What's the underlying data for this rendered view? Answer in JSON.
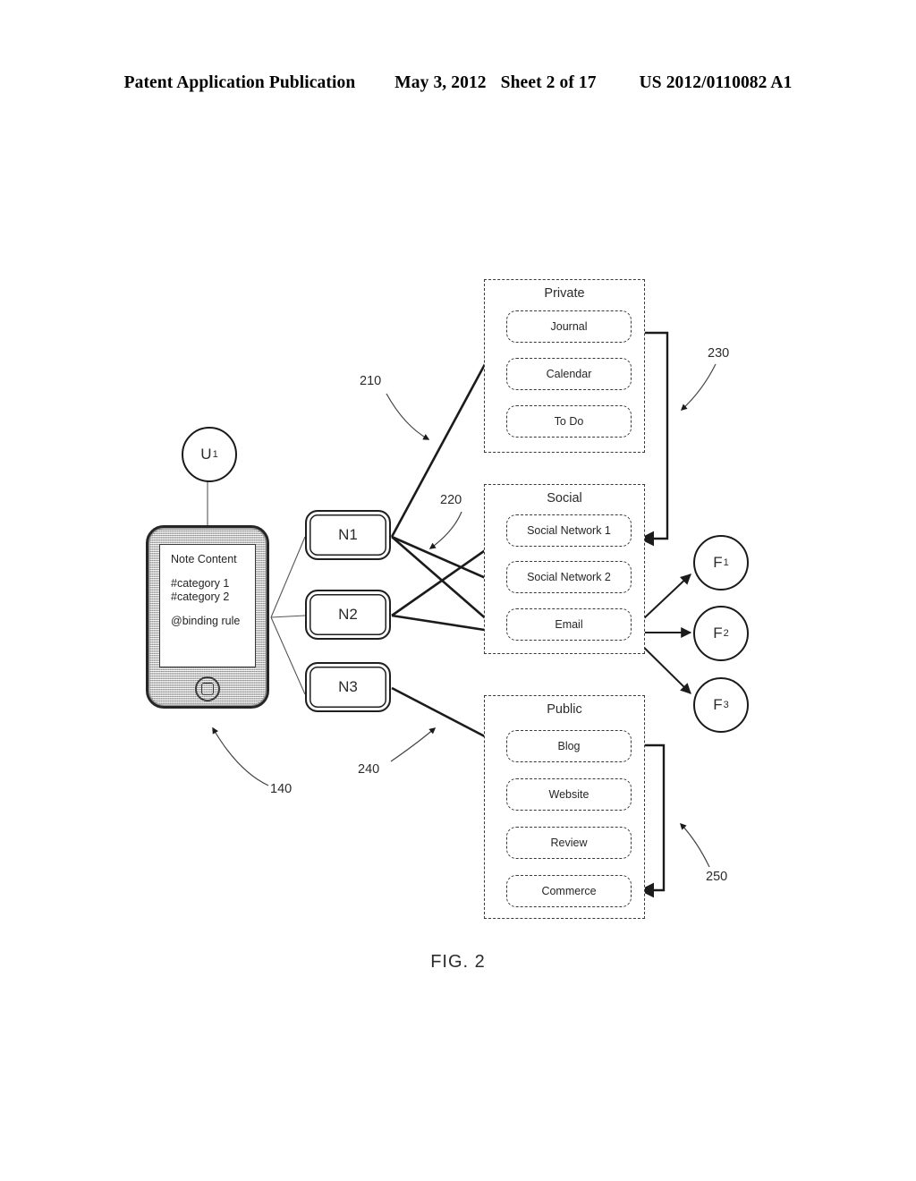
{
  "header": {
    "publication": "Patent Application Publication",
    "date": "May 3, 2012",
    "sheet": "Sheet 2 of 17",
    "number": "US 2012/0110082 A1"
  },
  "figure": {
    "caption": "FIG. 2"
  },
  "user_node": {
    "label": "U",
    "subscript": "1"
  },
  "phone": {
    "note_title": "Note Content",
    "category_1": "#category 1",
    "category_2": "#category 2",
    "binding_rule": "@binding rule"
  },
  "note_nodes": [
    {
      "label": "N",
      "subscript": "1"
    },
    {
      "label": "N",
      "subscript": "2"
    },
    {
      "label": "N",
      "subscript": "3"
    }
  ],
  "groups": [
    {
      "title": "Private",
      "items": [
        "Journal",
        "Calendar",
        "To Do"
      ]
    },
    {
      "title": "Social",
      "items": [
        "Social Network 1",
        "Social Network 2",
        "Email"
      ]
    },
    {
      "title": "Public",
      "items": [
        "Blog",
        "Website",
        "Review",
        "Commerce"
      ]
    }
  ],
  "friend_nodes": [
    {
      "label": "F",
      "subscript": "1"
    },
    {
      "label": "F",
      "subscript": "2"
    },
    {
      "label": "F",
      "subscript": "3"
    }
  ],
  "reference_numerals": {
    "device": "140",
    "private_link": "210",
    "social_link": "220",
    "private_group": "230",
    "public_link": "240",
    "public_group": "250"
  },
  "colors": {
    "ink": "#1f1f1f",
    "text": "#2b2b2b",
    "paper": "#ffffff",
    "device_fill": "#d2d2d2"
  }
}
